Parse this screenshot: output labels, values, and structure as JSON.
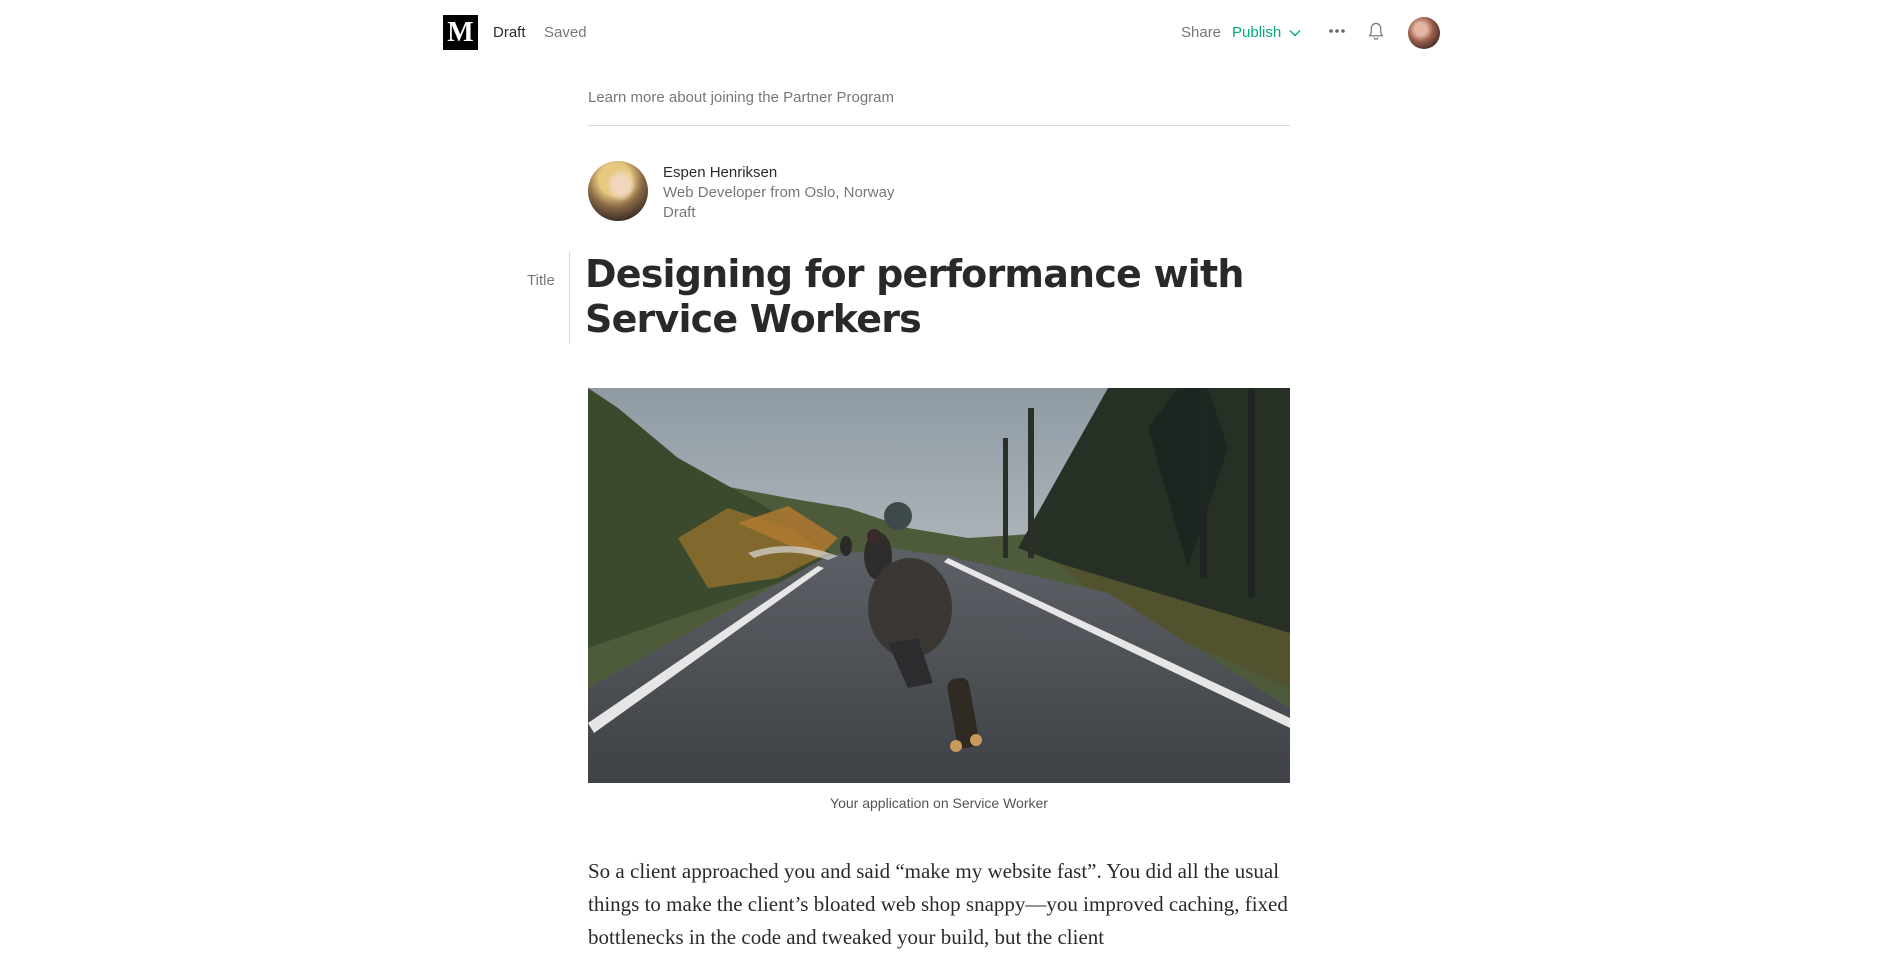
{
  "header": {
    "logo_letter": "M",
    "status": "Draft",
    "save_state": "Saved",
    "share_label": "Share",
    "publish_label": "Publish"
  },
  "partner_link": "Learn more about joining the Partner Program",
  "author": {
    "name": "Espen Henriksen",
    "bio": "Web Developer from Oslo, Norway",
    "status": "Draft"
  },
  "editor": {
    "title_label": "Title",
    "title": "Designing for performance with Service Workers",
    "image_caption": "Your application on Service Worker",
    "paragraph": "So a client approached you and said “make my website fast”. You did all the usual things to make the client’s bloated web shop snappy—you improved caching, fixed bottlenecks in the code and tweaked your build, but the client"
  },
  "colors": {
    "accent": "#03a87c",
    "text": "#292929",
    "muted": "#757575"
  },
  "icons": {
    "more": "more-horizontal-icon",
    "notifications": "bell-icon",
    "publish_menu": "chevron-down-icon"
  }
}
